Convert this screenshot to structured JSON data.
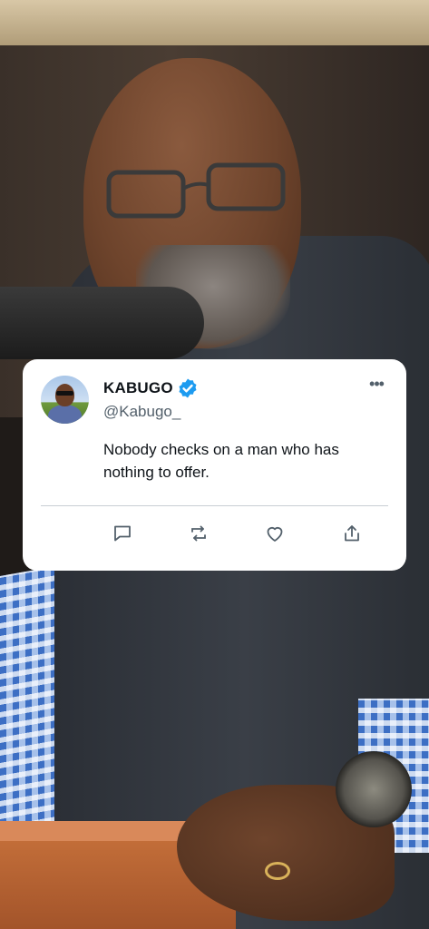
{
  "tweet": {
    "display_name": "KABUGO",
    "handle": "@Kabugo_",
    "text": "Nobody checks on a man who has nothing to offer.",
    "verified": true,
    "more_label": "•••"
  },
  "colors": {
    "verified_blue": "#1d9bf0",
    "icon_gray": "#53606b",
    "card_bg": "#ffffff",
    "text_primary": "#0f1419"
  },
  "actions": [
    {
      "icon": "reply-icon"
    },
    {
      "icon": "retweet-icon"
    },
    {
      "icon": "like-icon"
    },
    {
      "icon": "share-icon"
    }
  ]
}
